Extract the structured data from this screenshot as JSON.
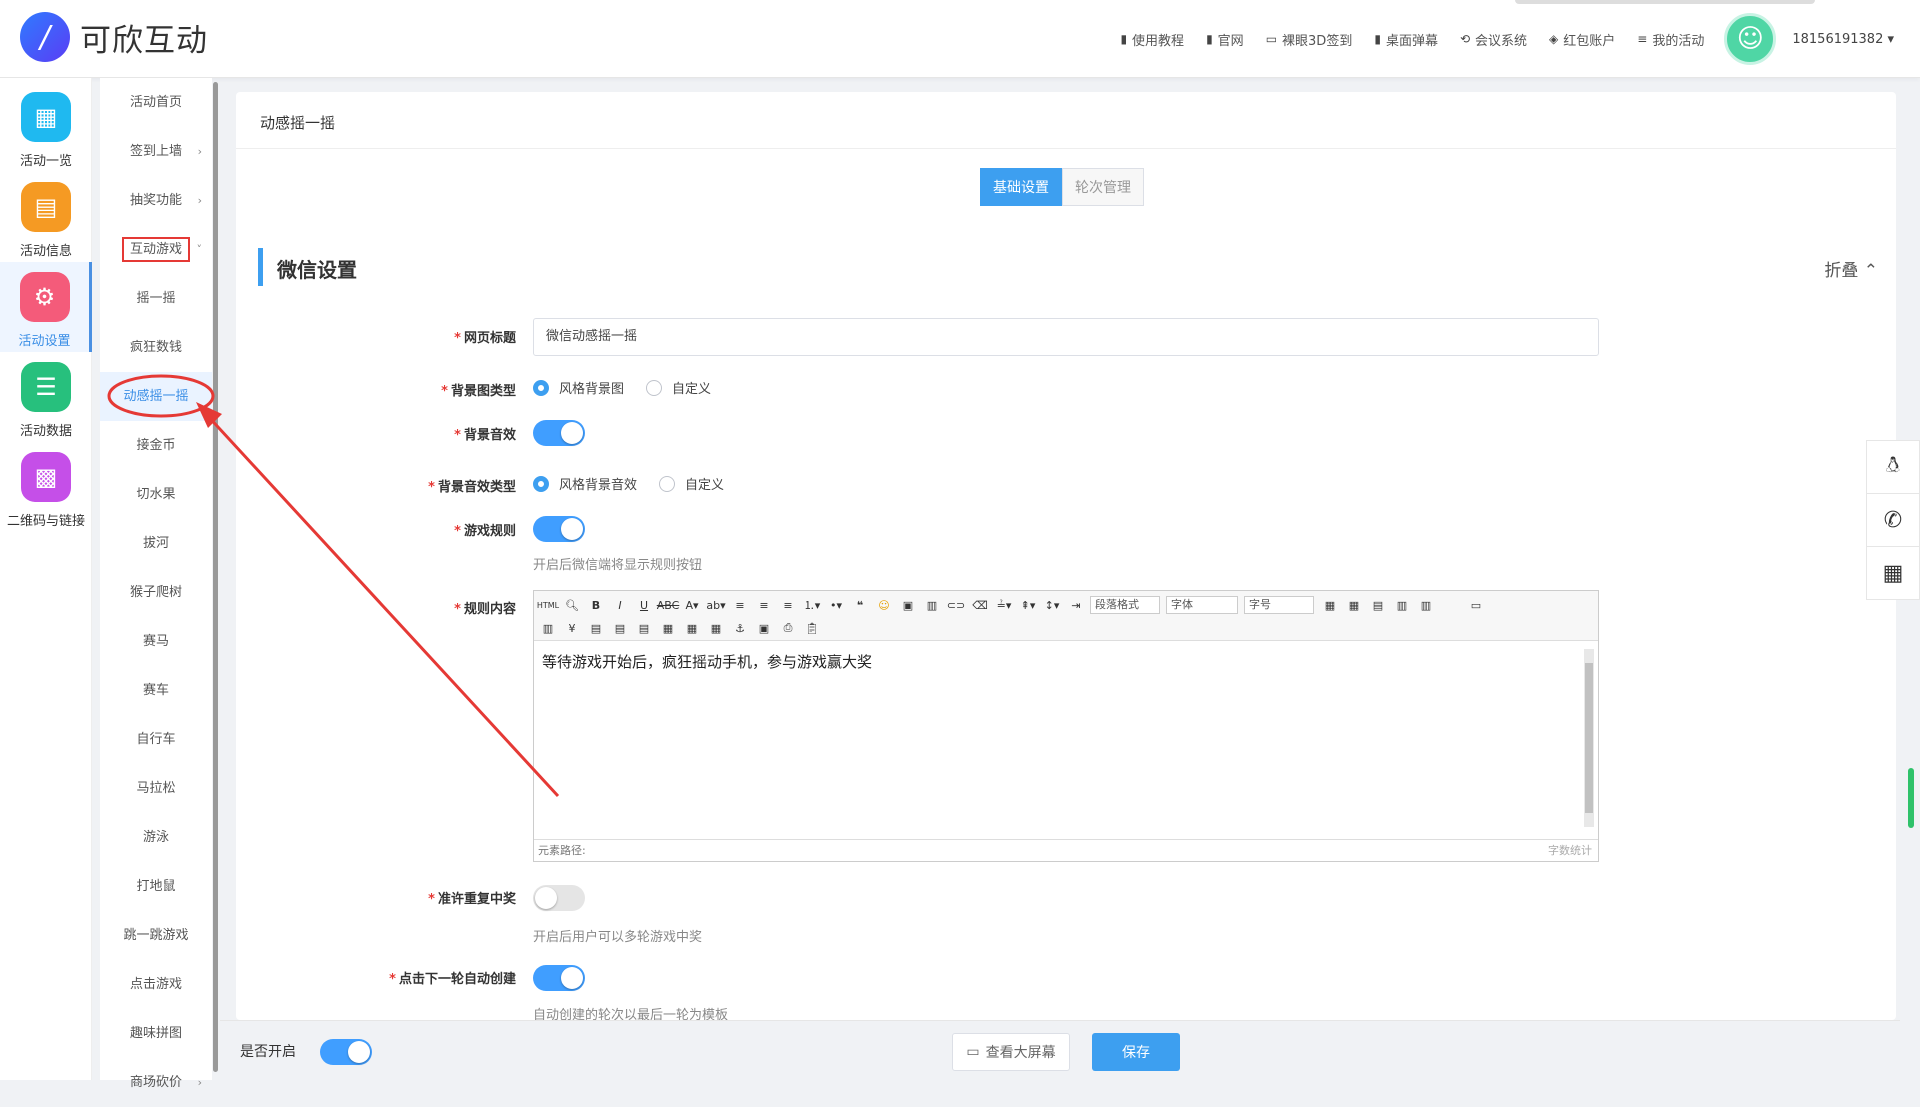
{
  "header": {
    "logo_glyph": "/",
    "brand": "可欣互动",
    "nav": [
      {
        "icon": "doc-icon",
        "label": "使用教程"
      },
      {
        "icon": "doc-icon",
        "label": "官网"
      },
      {
        "icon": "monitor-icon",
        "label": "裸眼3D签到"
      },
      {
        "icon": "doc-icon",
        "label": "桌面弹幕"
      },
      {
        "icon": "meeting-icon",
        "label": "会议系统"
      },
      {
        "icon": "diamond-icon",
        "label": "红包账户"
      },
      {
        "icon": "list-icon",
        "label": "我的活动"
      }
    ],
    "user": "18156191382 ▾"
  },
  "iconbar": [
    {
      "label": "活动一览",
      "color": "#1fb9f0",
      "icon": "grid-icon"
    },
    {
      "label": "活动信息",
      "color": "#f59a23",
      "icon": "document-icon"
    },
    {
      "label": "活动设置",
      "color": "#f45b7a",
      "icon": "gear-icon"
    },
    {
      "label": "活动数据",
      "color": "#27c07d",
      "icon": "database-icon"
    },
    {
      "label": "二维码与链接",
      "color": "#c54fe8",
      "icon": "qrcode-icon"
    }
  ],
  "submenu": [
    {
      "label": "活动首页",
      "chev": ""
    },
    {
      "label": "签到上墙",
      "chev": "›"
    },
    {
      "label": "抽奖功能",
      "chev": "›"
    },
    {
      "label": "互动游戏",
      "chev": "˅"
    },
    {
      "label": "摇一摇",
      "chev": ""
    },
    {
      "label": "疯狂数钱",
      "chev": ""
    },
    {
      "label": "动感摇一摇",
      "chev": ""
    },
    {
      "label": "接金币",
      "chev": ""
    },
    {
      "label": "切水果",
      "chev": ""
    },
    {
      "label": "拔河",
      "chev": ""
    },
    {
      "label": "猴子爬树",
      "chev": ""
    },
    {
      "label": "赛马",
      "chev": ""
    },
    {
      "label": "赛车",
      "chev": ""
    },
    {
      "label": "自行车",
      "chev": ""
    },
    {
      "label": "马拉松",
      "chev": ""
    },
    {
      "label": "游泳",
      "chev": ""
    },
    {
      "label": "打地鼠",
      "chev": ""
    },
    {
      "label": "跳一跳游戏",
      "chev": ""
    },
    {
      "label": "点击游戏",
      "chev": ""
    },
    {
      "label": "趣味拼图",
      "chev": ""
    },
    {
      "label": "商场砍价",
      "chev": "›"
    }
  ],
  "page": {
    "title": "动感摇一摇",
    "tabs": [
      "基础设置",
      "轮次管理"
    ],
    "section_title": "微信设置",
    "fold_label": "折叠 ⌃"
  },
  "form": {
    "page_title_label": "网页标题",
    "page_title_value": "微信动感摇一摇",
    "bg_type_label": "背景图类型",
    "bg_type_options": [
      "风格背景图",
      "自定义"
    ],
    "bg_sound_label": "背景音效",
    "bg_sound_type_label": "背景音效类型",
    "bg_sound_type_options": [
      "风格背景音效",
      "自定义"
    ],
    "rules_label": "游戏规则",
    "rules_hint": "开启后微信端将显示规则按钮",
    "rules_content_label": "规则内容",
    "rules_content": "等待游戏开始后，疯狂摇动手机，参与游戏赢大奖",
    "editor_path": "元素路径:",
    "editor_count": "字数统计",
    "editor_selects": [
      "段落格式",
      "字体",
      "字号"
    ],
    "repeat_label": "准许重复中奖",
    "repeat_hint": "开启后用户可以多轮游戏中奖",
    "auto_label": "点击下一轮自动创建",
    "auto_hint": "自动创建的轮次以最后一轮为模板"
  },
  "bottom": {
    "enable_label": "是否开启",
    "view_button": "查看大屏幕",
    "save_button": "保存"
  },
  "colors": {
    "accent": "#3d9ff0",
    "annotation": "#e53935"
  }
}
